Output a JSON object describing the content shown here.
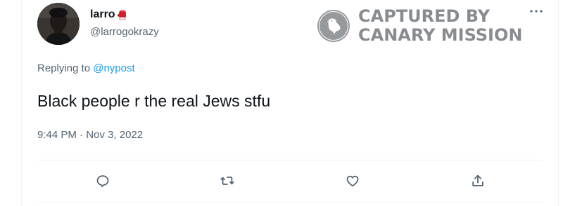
{
  "tweet": {
    "display_name": "larro",
    "name_emoji": "boxing-glove-icon",
    "handle": "@larrogokrazy",
    "reply_prefix": "Replying to",
    "reply_to": "@nypost",
    "text": "Black people r the real Jews stfu",
    "time": "9:44 PM",
    "separator": "·",
    "date": "Nov 3, 2022"
  },
  "watermark": {
    "line1": "CAPTURED BY",
    "line2": "CANARY MISSION",
    "logo": "canary-bird-icon"
  },
  "actions": [
    "reply-icon",
    "retweet-icon",
    "like-icon",
    "share-icon"
  ],
  "colors": {
    "link": "#1d9bf0",
    "secondary_text": "#536471",
    "primary_text": "#0f1419",
    "glove": "#d0202a",
    "watermark": "#5b6066"
  }
}
